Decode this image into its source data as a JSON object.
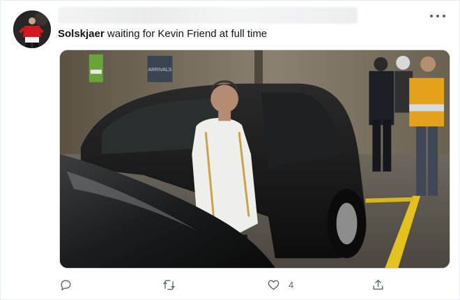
{
  "tweet": {
    "author": "Solskjaer",
    "text": "waiting for Kevin Friend at full time",
    "like_count": "4"
  },
  "photo": {
    "wall_sign": "ARRIVALS"
  },
  "icons": {
    "more": "more-horizontal-icon",
    "reply": "reply-icon",
    "retweet": "retweet-icon",
    "like": "heart-icon",
    "share": "share-icon"
  },
  "colors": {
    "icon": "#536471",
    "border": "#cfd9de"
  }
}
